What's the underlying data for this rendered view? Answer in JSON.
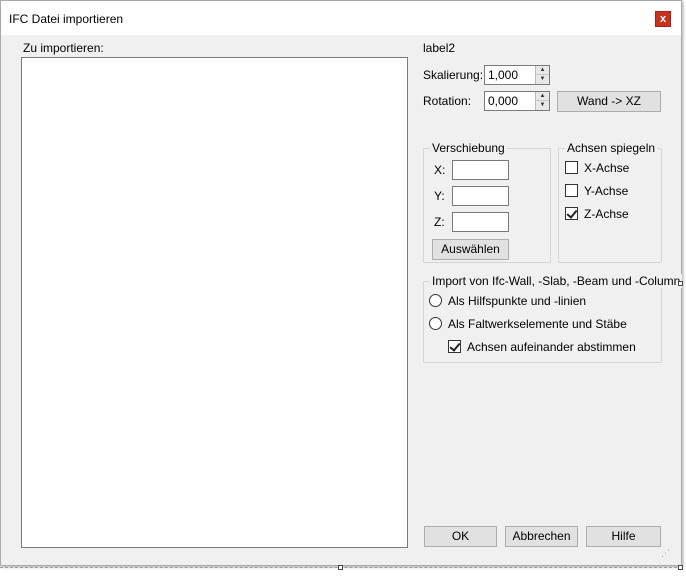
{
  "window": {
    "title": "IFC Datei importieren",
    "close_glyph": "x"
  },
  "left": {
    "list_label": "Zu importieren:"
  },
  "right": {
    "label2": "label2",
    "scale_label": "Skalierung:",
    "scale_value": "1,000",
    "rotation_label": "Rotation:",
    "rotation_value": "0,000",
    "wall_button": "Wand -> XZ"
  },
  "offset_group": {
    "title": "Verschiebung",
    "x_label": "X:",
    "y_label": "Y:",
    "z_label": "Z:",
    "x_value": "",
    "y_value": "",
    "z_value": "",
    "select_button": "Auswählen"
  },
  "mirror_group": {
    "title": "Achsen spiegeln",
    "x_label": "X-Achse",
    "y_label": "Y-Achse",
    "z_label": "Z-Achse",
    "x_checked": false,
    "y_checked": false,
    "z_checked": true
  },
  "import_group": {
    "title": "Import von Ifc-Wall, -Slab, -Beam und -Column",
    "radio1_label": "Als Hilfspunkte und -linien",
    "radio2_label": "Als Faltwerkselemente und Stäbe",
    "sync_label": "Achsen aufeinander abstimmen",
    "sync_checked": true
  },
  "footer": {
    "ok": "OK",
    "cancel": "Abbrechen",
    "help": "Hilfe"
  }
}
